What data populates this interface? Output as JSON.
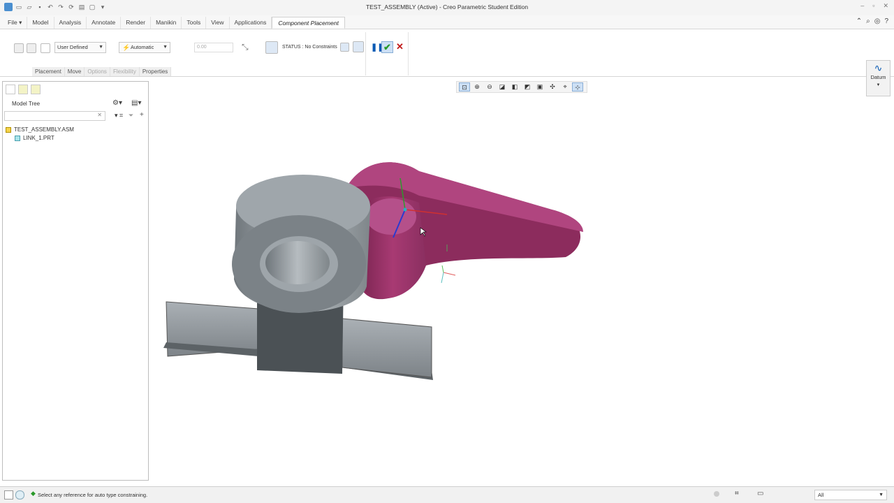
{
  "window": {
    "title": "TEST_ASSEMBLY (Active) - Creo Parametric Student Edition"
  },
  "menu": {
    "file": "File",
    "tabs": [
      "Model",
      "Analysis",
      "Annotate",
      "Render",
      "Manikin",
      "Tools",
      "View",
      "Applications"
    ],
    "active_tab": "Component Placement"
  },
  "ribbon": {
    "constraint_set": "User Defined",
    "constraint_type": "Automatic",
    "offset_value": "0.00",
    "status_text": "STATUS : No Constraints",
    "subtabs": [
      "Placement",
      "Move",
      "Options",
      "Flexibility",
      "Properties"
    ],
    "datum_label": "Datum"
  },
  "model_tree": {
    "label": "Model Tree",
    "search_placeholder": "",
    "items": [
      {
        "name": "TEST_ASSEMBLY.ASM",
        "type": "assembly"
      },
      {
        "name": "LINK_1.PRT",
        "type": "part"
      }
    ]
  },
  "statusbar": {
    "message": "Select any reference for auto type constraining.",
    "filter_value": "All"
  },
  "colors": {
    "ribbon_accent": "#0a5ab4",
    "confirm_green": "#2a9a2a",
    "cancel_red": "#c01818",
    "link_part": "#8a2a5a",
    "base_part": "#8f969b"
  },
  "icons": [
    "search-icon",
    "help-icon",
    "pause-icon",
    "check-icon",
    "close-icon",
    "datum-icon"
  ]
}
